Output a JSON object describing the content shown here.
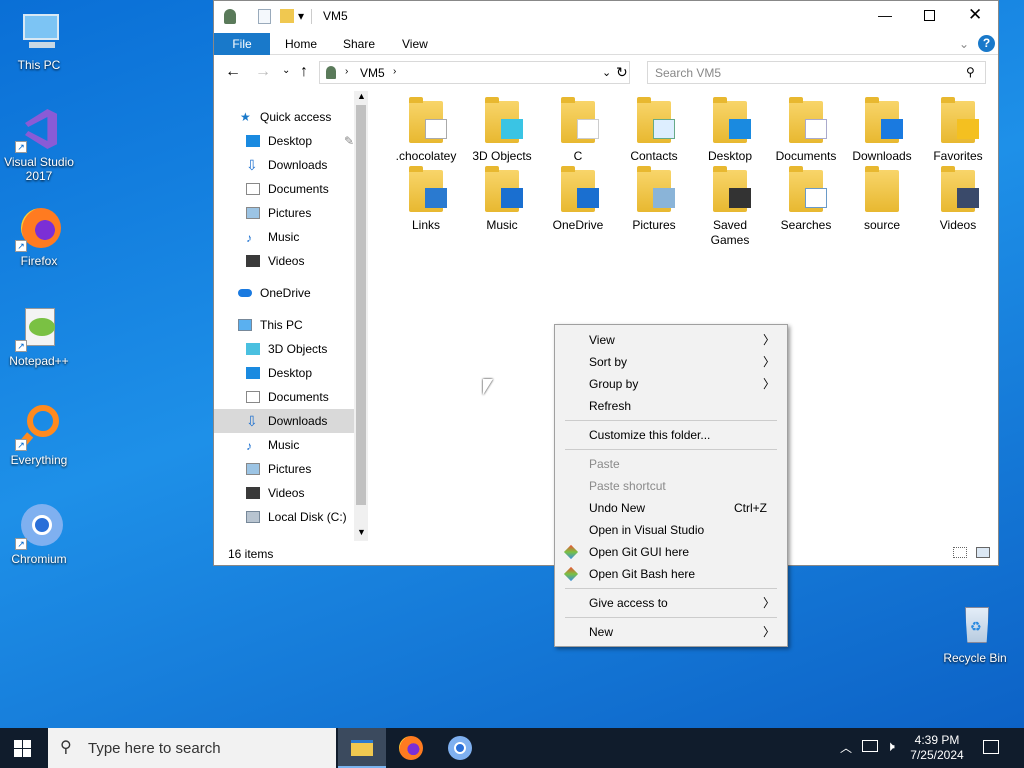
{
  "desktop": {
    "icons": [
      {
        "label": "This PC"
      },
      {
        "label": "Visual Studio 2017"
      },
      {
        "label": "Firefox"
      },
      {
        "label": "Notepad++"
      },
      {
        "label": "Everything"
      },
      {
        "label": "Chromium"
      },
      {
        "label": "Recycle Bin"
      }
    ]
  },
  "explorer": {
    "title": "VM5",
    "tabs": [
      "File",
      "Home",
      "Share",
      "View"
    ],
    "address": "VM5",
    "search_placeholder": "Search VM5",
    "status": "16 items",
    "nav": {
      "quick_access": "Quick access",
      "qa_items": [
        "Desktop",
        "Downloads",
        "Documents",
        "Pictures",
        "Music",
        "Videos"
      ],
      "onedrive": "OneDrive",
      "this_pc": "This PC",
      "pc_items": [
        "3D Objects",
        "Desktop",
        "Documents",
        "Downloads",
        "Music",
        "Pictures",
        "Videos",
        "Local Disk (C:)"
      ]
    },
    "items": [
      ".chocolatey",
      "3D Objects",
      "C",
      "Contacts",
      "Desktop",
      "Documents",
      "Downloads",
      "Favorites",
      "Links",
      "Music",
      "OneDrive",
      "Pictures",
      "Saved Games",
      "Searches",
      "source",
      "Videos"
    ]
  },
  "context_menu": {
    "view": "View",
    "sort_by": "Sort by",
    "group_by": "Group by",
    "refresh": "Refresh",
    "customize": "Customize this folder...",
    "paste": "Paste",
    "paste_shortcut": "Paste shortcut",
    "undo_new": "Undo New",
    "undo_shortcut": "Ctrl+Z",
    "open_vs": "Open in Visual Studio",
    "git_gui": "Open Git GUI here",
    "git_bash": "Open Git Bash here",
    "give_access": "Give access to",
    "new": "New"
  },
  "taskbar": {
    "search_placeholder": "Type here to search",
    "time": "4:39 PM",
    "date": "7/25/2024"
  }
}
